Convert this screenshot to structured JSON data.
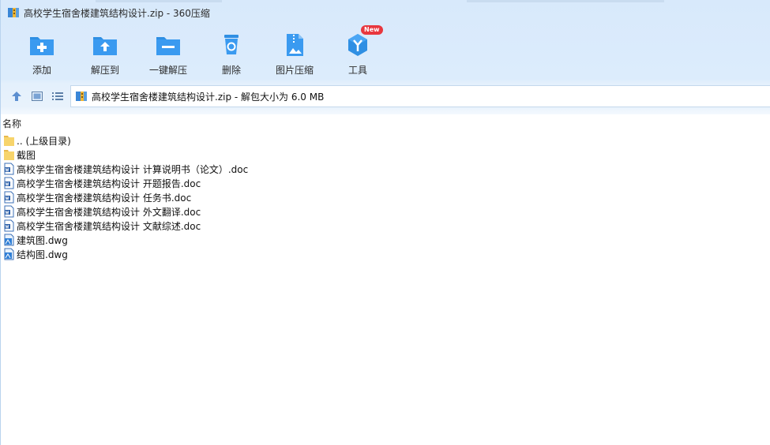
{
  "window": {
    "title": "高校学生宿舍楼建筑结构设计.zip - 360压缩"
  },
  "toolbar": {
    "items": [
      {
        "label": "添加",
        "icon": "add-folder-icon"
      },
      {
        "label": "解压到",
        "icon": "extract-to-icon"
      },
      {
        "label": "一键解压",
        "icon": "one-click-extract-icon"
      },
      {
        "label": "删除",
        "icon": "recycle-bin-icon"
      },
      {
        "label": "图片压缩",
        "icon": "image-compress-icon"
      },
      {
        "label": "工具",
        "icon": "tools-icon",
        "badge": "New"
      }
    ]
  },
  "nav": {
    "address": "高校学生宿舍楼建筑结构设计.zip - 解包大小为 6.0 MB"
  },
  "list": {
    "column_name": "名称",
    "items": [
      {
        "name": ".. (上级目录)",
        "type": "folder"
      },
      {
        "name": "截图",
        "type": "folder"
      },
      {
        "name": "高校学生宿舍楼建筑结构设计 计算说明书（论文）.doc",
        "type": "doc"
      },
      {
        "name": "高校学生宿舍楼建筑结构设计 开题报告.doc",
        "type": "doc"
      },
      {
        "name": "高校学生宿舍楼建筑结构设计 任务书.doc",
        "type": "doc"
      },
      {
        "name": "高校学生宿舍楼建筑结构设计 外文翻译.doc",
        "type": "doc"
      },
      {
        "name": "高校学生宿舍楼建筑结构设计 文献综述.doc",
        "type": "doc"
      },
      {
        "name": "建筑图.dwg",
        "type": "dwg"
      },
      {
        "name": "结构图.dwg",
        "type": "dwg"
      }
    ]
  },
  "colors": {
    "accent": "#2f8fe3",
    "folder": "#f7d46b",
    "badge": "#e8373e"
  }
}
